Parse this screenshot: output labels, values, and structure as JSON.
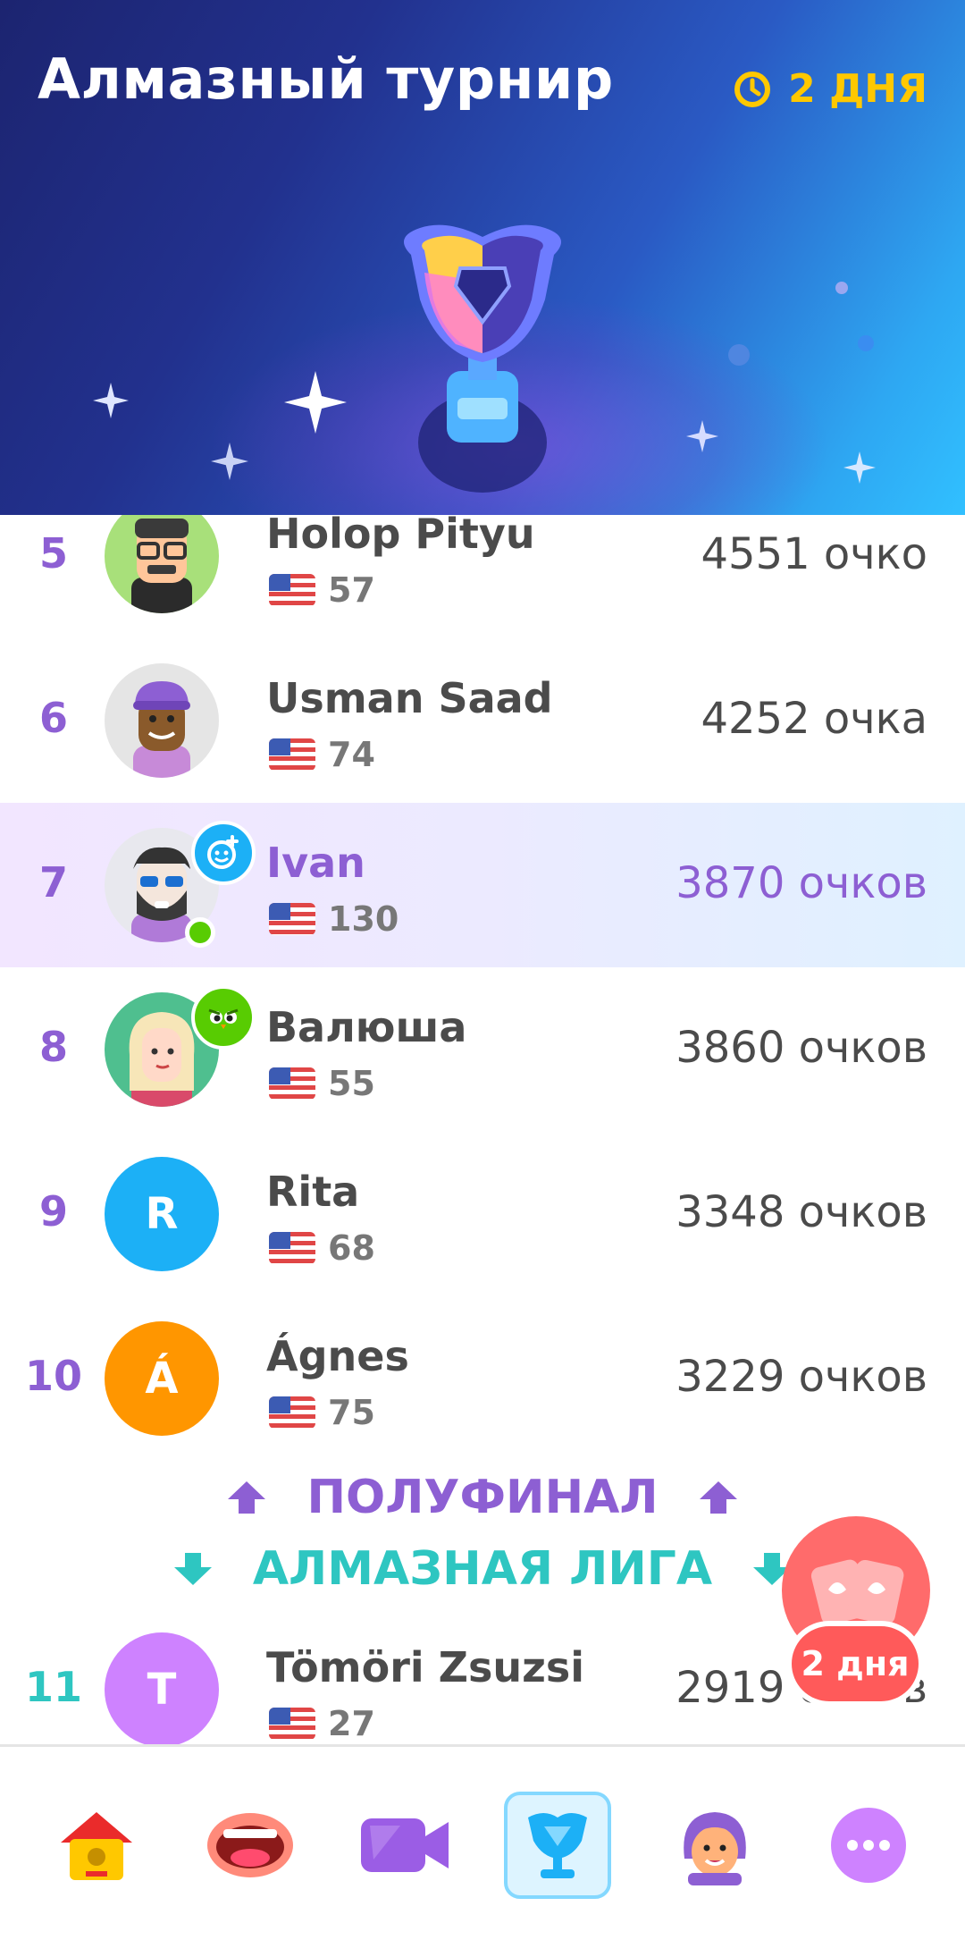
{
  "header": {
    "title": "Алмазный турнир",
    "timer_label": "2 ДНЯ",
    "colors": {
      "timer": "#ffc800",
      "title": "#ffffff"
    }
  },
  "leaderboard": {
    "rows": [
      {
        "rank": "5",
        "name": "Holop Pityu",
        "streak": "57",
        "score": "4551 очко"
      },
      {
        "rank": "6",
        "name": "Usman Saad",
        "streak": "74",
        "score": "4252 очка"
      },
      {
        "rank": "7",
        "name": "Ivan",
        "streak": "130",
        "score": "3870 очков",
        "current_user": true
      },
      {
        "rank": "8",
        "name": "Валюша",
        "streak": "55",
        "score": "3860 очков"
      },
      {
        "rank": "9",
        "name": "Rita",
        "streak": "68",
        "score": "3348 очков",
        "initial": "R"
      },
      {
        "rank": "10",
        "name": "Ágnes",
        "streak": "75",
        "score": "3229 очков",
        "initial": "Á"
      },
      {
        "rank": "11",
        "name": "Tömöri Zsuzsi",
        "streak": "27",
        "score": "2919 очков",
        "initial": "T"
      }
    ],
    "promotion_zone_label": "ПОЛУФИНАЛ",
    "demotion_zone_label": "АЛМАЗНАЯ ЛИГА",
    "colors": {
      "accent_purple": "#8d5fd3",
      "accent_teal": "#2ec6c1"
    }
  },
  "chest_button": {
    "label": "2 дня"
  },
  "bottom_nav": {
    "items": [
      {
        "icon": "home-icon",
        "active": false
      },
      {
        "icon": "speaking-mouth-icon",
        "active": false
      },
      {
        "icon": "video-camera-icon",
        "active": false
      },
      {
        "icon": "leaderboard-trophy-icon",
        "active": true
      },
      {
        "icon": "profile-character-icon",
        "active": false
      },
      {
        "icon": "more-icon",
        "active": false
      }
    ]
  }
}
